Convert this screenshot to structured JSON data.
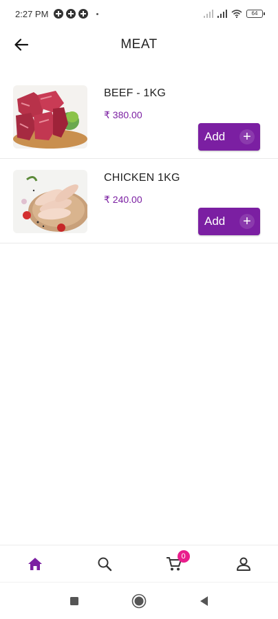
{
  "status_bar": {
    "time": "2:27 PM",
    "battery": "64"
  },
  "header": {
    "title": "MEAT"
  },
  "products": [
    {
      "name": "BEEF - 1KG",
      "price": "₹ 380.00",
      "add_label": "Add",
      "add_icon": "+"
    },
    {
      "name": "CHICKEN 1KG",
      "price": "₹ 240.00",
      "add_label": "Add",
      "add_icon": "+"
    }
  ],
  "bottom_nav": {
    "items": [
      "home-icon",
      "search-icon",
      "cart-icon",
      "profile-icon"
    ],
    "cart_count": "0"
  },
  "colors": {
    "accent": "#7b1fa2",
    "badge": "#e91e8c"
  }
}
